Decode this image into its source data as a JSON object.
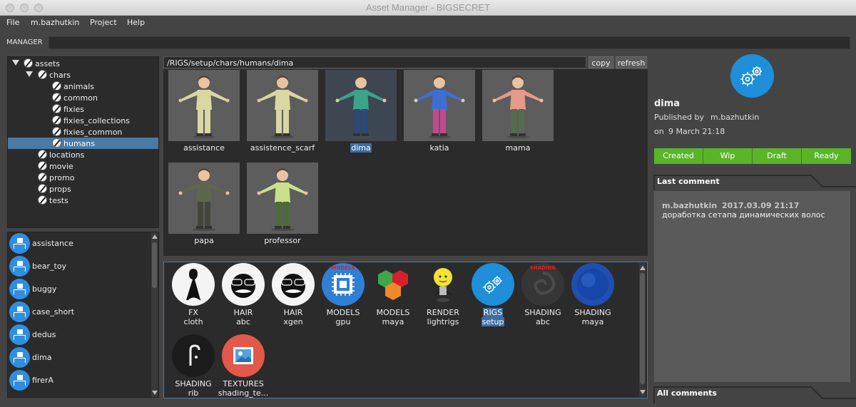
{
  "window": {
    "title": "Asset Manager - BIGSECRET"
  },
  "menu": [
    "File",
    "m.bazhutkin",
    "Project",
    "Help"
  ],
  "manager": {
    "label": "MANAGER",
    "value": ""
  },
  "tree": [
    {
      "label": "assets",
      "level": 0,
      "expanded": true
    },
    {
      "label": "chars",
      "level": 1,
      "expanded": true
    },
    {
      "label": "animals",
      "level": 2
    },
    {
      "label": "common",
      "level": 2
    },
    {
      "label": "fixies",
      "level": 2
    },
    {
      "label": "fixies_collections",
      "level": 2
    },
    {
      "label": "fixies_common",
      "level": 2
    },
    {
      "label": "humans",
      "level": 2,
      "selected": true
    },
    {
      "label": "locations",
      "level": 1
    },
    {
      "label": "movie",
      "level": 1
    },
    {
      "label": "promo",
      "level": 1
    },
    {
      "label": "props",
      "level": 1
    },
    {
      "label": "tests",
      "level": 1
    }
  ],
  "asset_list": [
    "assistance",
    "bear_toy",
    "buggy",
    "case_short",
    "dedus",
    "dima",
    "firerA"
  ],
  "path": {
    "value": "/RIGS/setup/chars/humans/dima",
    "copy_label": "copy",
    "refresh_label": "refresh"
  },
  "characters": [
    {
      "label": "assistance",
      "shirt": "#d9d7a2",
      "legs": "#d9d7a2"
    },
    {
      "label": "assistence_scarf",
      "shirt": "#d9d7a2",
      "legs": "#d9d7a2"
    },
    {
      "label": "dima",
      "shirt": "#3aa38a",
      "legs": "#2c4a78",
      "selected": true
    },
    {
      "label": "katia",
      "shirt": "#3d6fd1",
      "legs": "#c04a8e"
    },
    {
      "label": "mama",
      "shirt": "#e59a8b",
      "legs": "#556b4e"
    },
    {
      "label": "papa",
      "shirt": "#5f6650",
      "legs": "#44463d"
    },
    {
      "label": "professor",
      "shirt": "#cbe08a",
      "legs": "#4d6b39"
    }
  ],
  "departments": [
    {
      "line1": "FX",
      "line2": "cloth",
      "icon": "fx-cloth-icon",
      "bg": "#f4f4f4"
    },
    {
      "line1": "HAIR",
      "line2": "abc",
      "icon": "hair-abc-icon",
      "bg": "#f4f4f4"
    },
    {
      "line1": "HAIR",
      "line2": "xgen",
      "icon": "hair-xgen-icon",
      "bg": "#f4f4f4"
    },
    {
      "line1": "MODELS",
      "line2": "gpu",
      "icon": "models-gpu-icon",
      "bg": "#2f7fd4",
      "badge": "MODELS"
    },
    {
      "line1": "MODELS",
      "line2": "maya",
      "icon": "models-maya-icon",
      "bg": "transparent"
    },
    {
      "line1": "RENDER",
      "line2": "lightrigs",
      "icon": "render-lightrigs-icon",
      "bg": "transparent"
    },
    {
      "line1": "RIGS",
      "line2": "setup",
      "icon": "rigs-setup-icon",
      "bg": "#1e8fd8",
      "selected": true
    },
    {
      "line1": "SHADING",
      "line2": "abc",
      "icon": "shading-abc-icon",
      "bg": "#363636",
      "badge": "SHADING"
    },
    {
      "line1": "SHADING",
      "line2": "maya",
      "icon": "shading-maya-icon",
      "bg": "#1f4fb0"
    },
    {
      "line1": "SHADING",
      "line2": "rib",
      "icon": "shading-rib-icon",
      "bg": "#1b1b1b"
    },
    {
      "line1": "TEXTURES",
      "line2": "shading_te...",
      "icon": "textures-shading-icon",
      "bg": "#e2584a"
    }
  ],
  "details": {
    "name": "dima",
    "published_by_label": "Published by",
    "published_by": "m.bazhutkin",
    "on_label": "on",
    "date": "9 March 21:18",
    "statuses": [
      "Created",
      "Wip",
      "Draft",
      "Ready"
    ],
    "status_color": "#5ab42a",
    "last_comment_label": "Last comment",
    "comment": {
      "author": "m.bazhutkin",
      "time": "2017.03.09   21:17",
      "text": "доработка сетапа динамических волос"
    },
    "all_comments_label": "All comments"
  }
}
